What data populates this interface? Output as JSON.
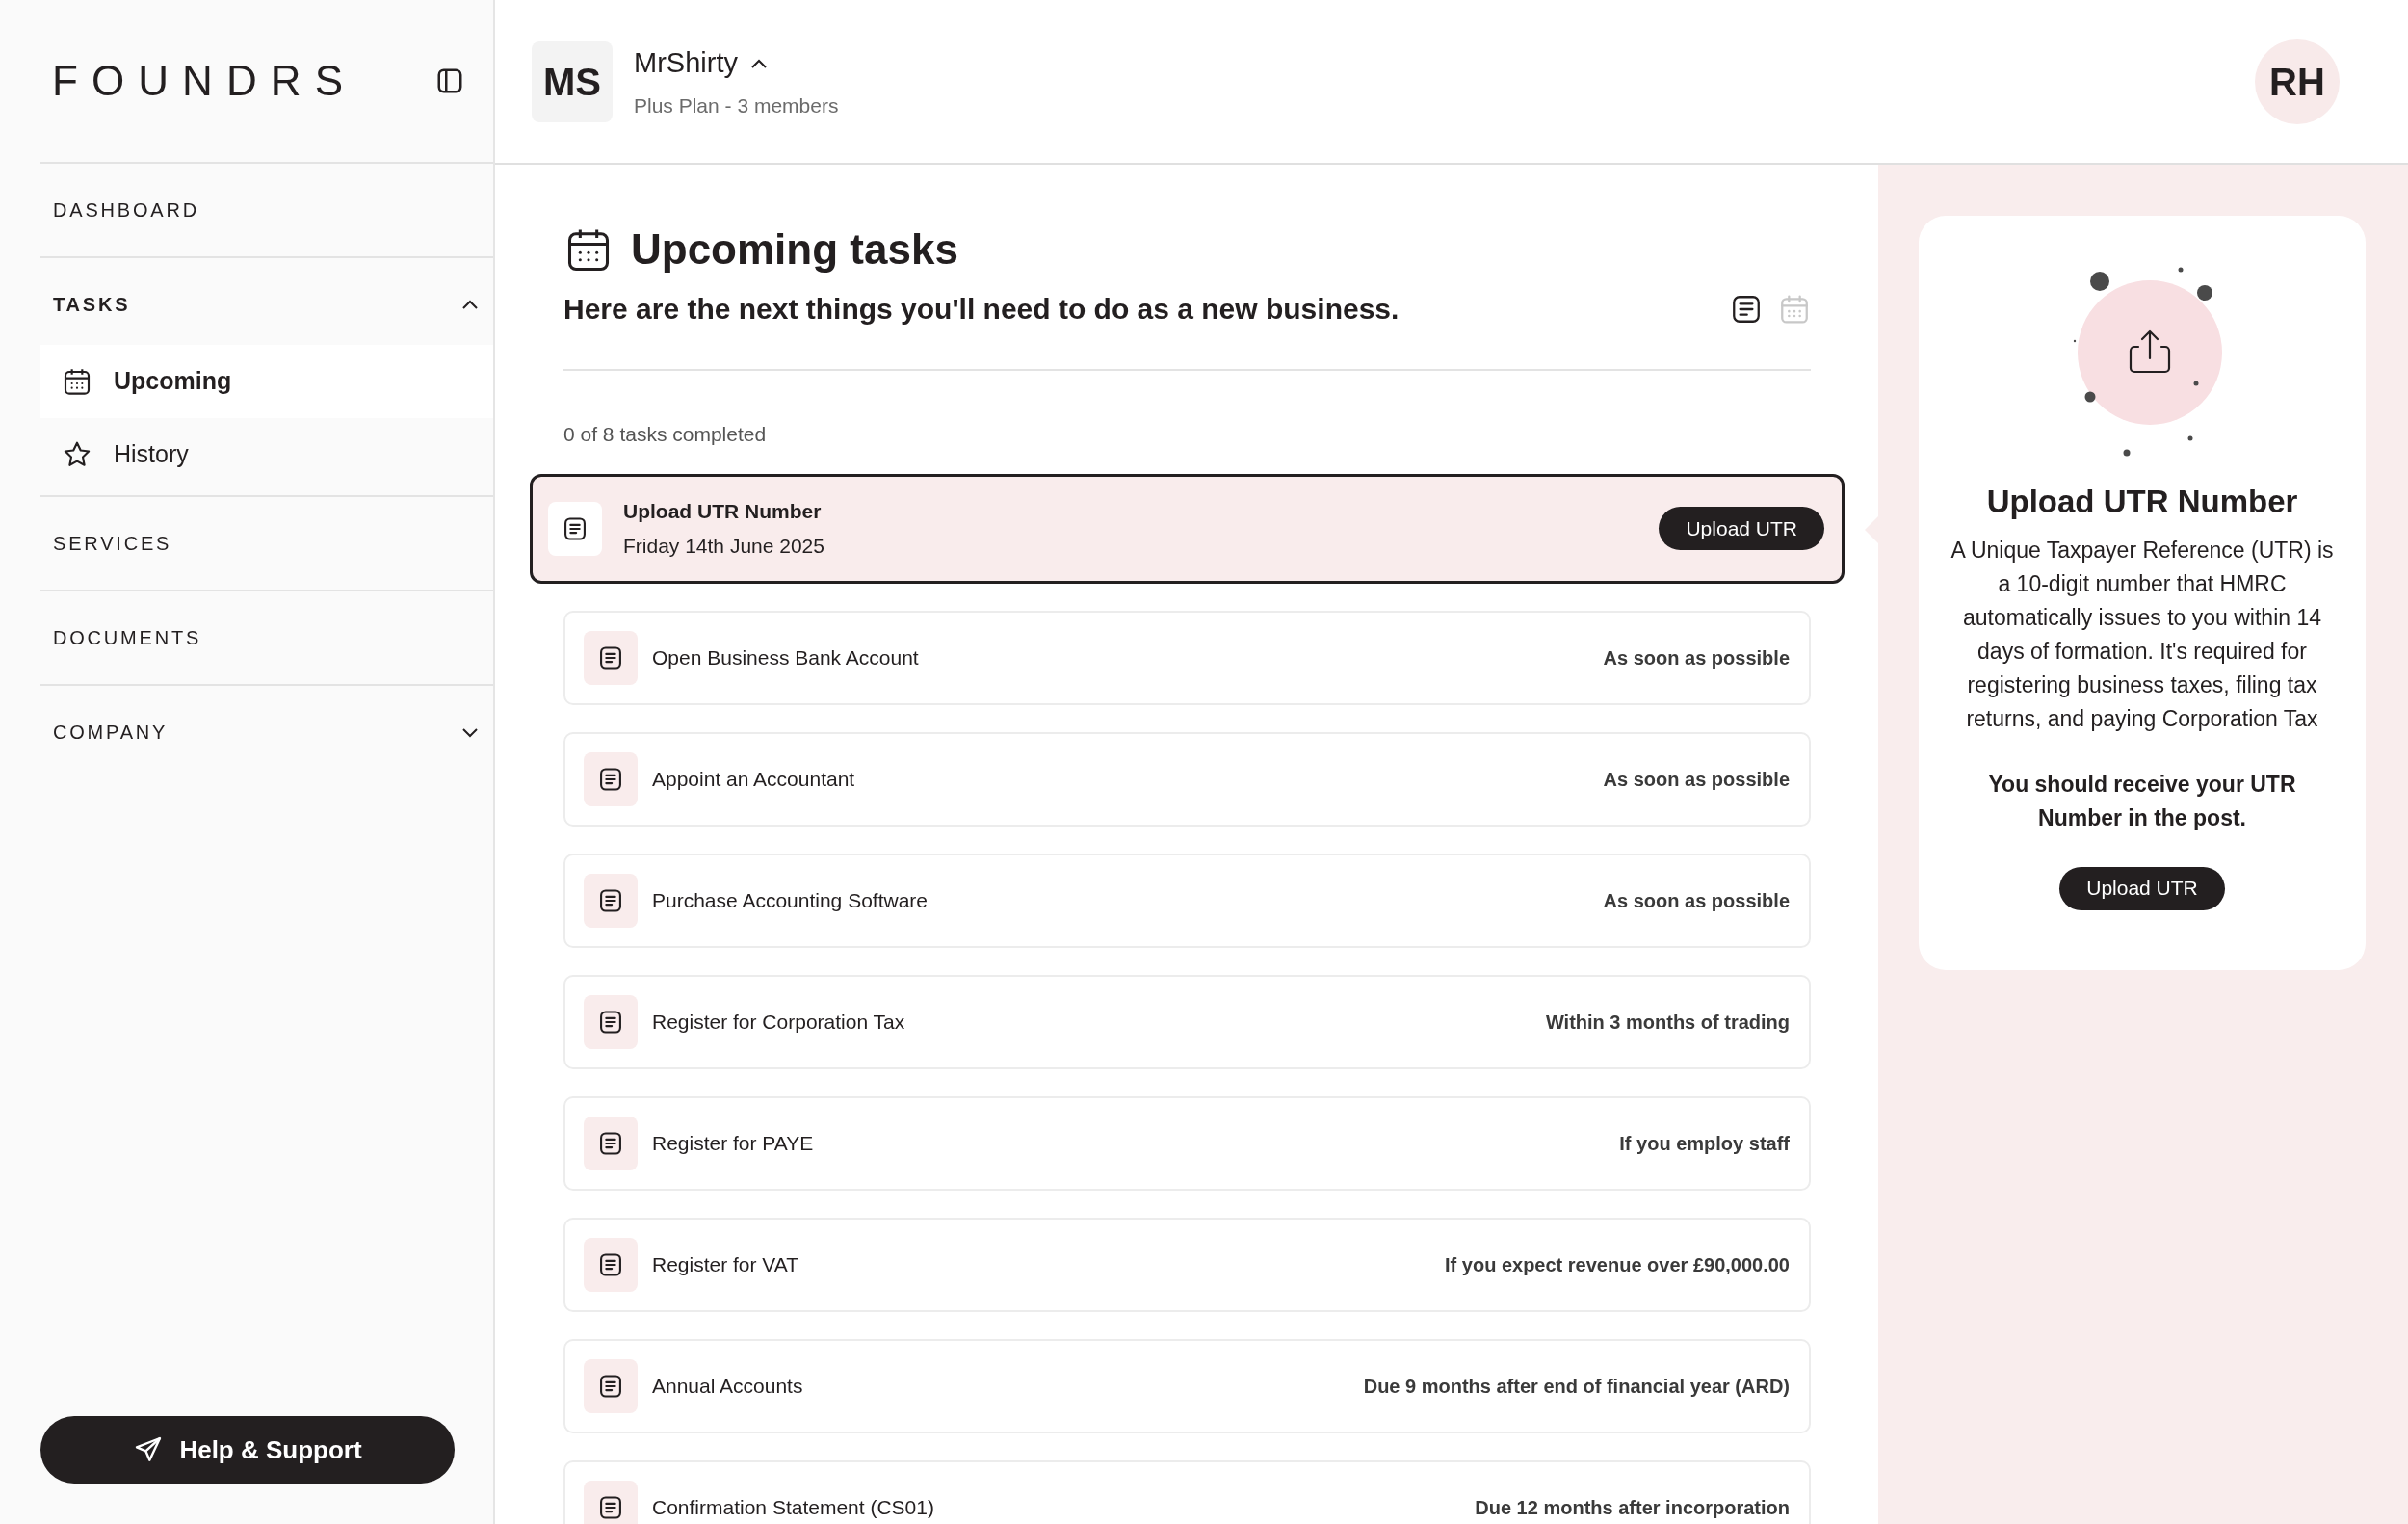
{
  "sidebar": {
    "logo": "FOUNDRS",
    "nav": [
      {
        "label": "DASHBOARD"
      },
      {
        "label": "TASKS",
        "expanded": true,
        "children": [
          {
            "label": "Upcoming",
            "kind": "calendar",
            "selected": true
          },
          {
            "label": "History",
            "kind": "star",
            "selected": false
          }
        ]
      },
      {
        "label": "SERVICES"
      },
      {
        "label": "DOCUMENTS"
      },
      {
        "label": "COMPANY",
        "expanded": false
      }
    ],
    "help_button": "Help & Support"
  },
  "header": {
    "workspace_initials": "MS",
    "workspace_name": "MrShirty",
    "workspace_plan": "Plus Plan - 3 members",
    "user_initials": "RH"
  },
  "main": {
    "title": "Upcoming tasks",
    "subtitle": "Here are the next things you'll need to do as a new business.",
    "view_toggle": [
      {
        "kind": "list",
        "selected": true
      },
      {
        "kind": "calendar",
        "selected": false
      }
    ],
    "progress": "0 of 8 tasks completed",
    "tasks": [
      {
        "title": "Upload UTR Number",
        "date": "Friday 14th June 2025",
        "button": "Upload UTR",
        "selected": true
      },
      {
        "title": "Open Business Bank Account",
        "due": "As soon as possible",
        "selected": false
      },
      {
        "title": "Appoint an Accountant",
        "due": "As soon as possible",
        "selected": false
      },
      {
        "title": "Purchase Accounting Software",
        "due": "As soon as possible",
        "selected": false
      },
      {
        "title": "Register for Corporation Tax",
        "due": "Within 3 months of trading",
        "selected": false
      },
      {
        "title": "Register for PAYE",
        "due": "If you employ staff",
        "selected": false
      },
      {
        "title": "Register for VAT",
        "due": "If you expect revenue over £90,000.00",
        "selected": false
      },
      {
        "title": "Annual Accounts",
        "due": "Due 9 months after end of financial year (ARD)",
        "selected": false
      },
      {
        "title": "Confirmation Statement (CS01)",
        "due": "Due 12 months after incorporation",
        "selected": false
      }
    ]
  },
  "detail": {
    "title": "Upload UTR Number",
    "description": "A Unique Taxpayer Reference (UTR) is a 10-digit number that HMRC automatically issues to you within 14 days of formation. It's required for registering business taxes, filing tax returns, and paying Corporation Tax",
    "note": "You should receive your UTR Number in the post.",
    "button": "Upload UTR"
  }
}
